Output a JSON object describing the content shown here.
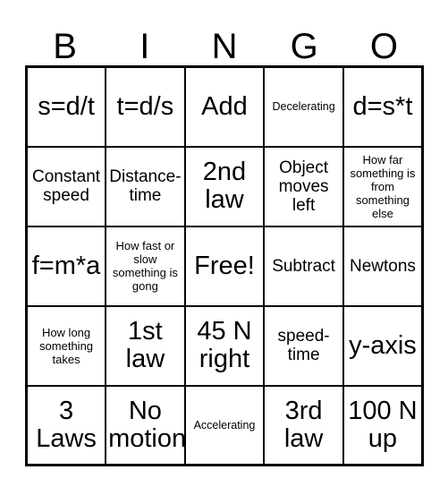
{
  "card": {
    "title_letters": [
      "B",
      "I",
      "N",
      "G",
      "O"
    ],
    "free_space_label": "Free!",
    "colors": {
      "border": "#000000",
      "text": "#000000",
      "background": "#ffffff"
    },
    "rows": [
      [
        {
          "text": "s=d/t",
          "size": "lg"
        },
        {
          "text": "t=d/s",
          "size": "lg"
        },
        {
          "text": "Add",
          "size": "lg"
        },
        {
          "text": "Decelerating",
          "size": "xs"
        },
        {
          "text": "d=s*t",
          "size": "lg"
        }
      ],
      [
        {
          "text": "Constant speed",
          "size": "md"
        },
        {
          "text": "Distance-time",
          "size": "md"
        },
        {
          "text": "2nd law",
          "size": "lg"
        },
        {
          "text": "Object moves left",
          "size": "md"
        },
        {
          "text": "How far something is from something else",
          "size": "sm"
        }
      ],
      [
        {
          "text": "f=m*a",
          "size": "lg"
        },
        {
          "text": "How fast or slow something is gong",
          "size": "sm"
        },
        {
          "text": "Free!",
          "size": "lg"
        },
        {
          "text": "Subtract",
          "size": "md"
        },
        {
          "text": "Newtons",
          "size": "md"
        }
      ],
      [
        {
          "text": "How long something takes",
          "size": "sm"
        },
        {
          "text": "1st law",
          "size": "lg"
        },
        {
          "text": "45 N right",
          "size": "lg"
        },
        {
          "text": "speed-time",
          "size": "md"
        },
        {
          "text": "y-axis",
          "size": "lg"
        }
      ],
      [
        {
          "text": "3 Laws",
          "size": "lg"
        },
        {
          "text": "No motion",
          "size": "lg"
        },
        {
          "text": "Accelerating",
          "size": "xs"
        },
        {
          "text": "3rd law",
          "size": "lg"
        },
        {
          "text": "100 N up",
          "size": "lg"
        }
      ]
    ]
  }
}
